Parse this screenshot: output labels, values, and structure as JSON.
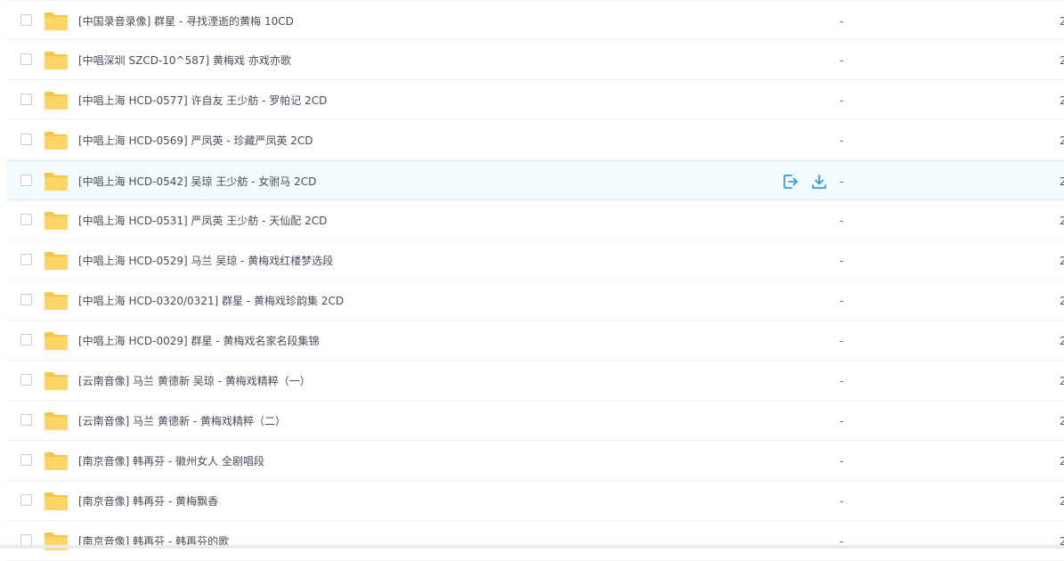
{
  "colors": {
    "accent": "#2f9cf0",
    "folder": "#ffd666",
    "hover_bg": "#f4fbff"
  },
  "icons": {
    "folder": "folder-icon",
    "share": "share-icon",
    "download": "download-icon"
  },
  "rows": [
    {
      "name": "[中国录音录像] 群星 - 寻找湮逝的黄梅 10CD",
      "size": "-",
      "edge": "2"
    },
    {
      "name": "[中唱深圳 SZCD-10^587] 黄梅戏 亦戏亦歌",
      "size": "-",
      "edge": "2"
    },
    {
      "name": "[中唱上海 HCD-0577] 许自友 王少舫 - 罗帕记 2CD",
      "size": "-",
      "edge": "2"
    },
    {
      "name": "[中唱上海 HCD-0569] 严凤英 - 珍藏严凤英 2CD",
      "size": "-",
      "edge": "2"
    },
    {
      "name": "[中唱上海 HCD-0542] 吴琼 王少舫 - 女驸马 2CD",
      "size": "-",
      "edge": "2",
      "hover": true
    },
    {
      "name": "[中唱上海 HCD-0531] 严凤英 王少舫 - 天仙配 2CD",
      "size": "-",
      "edge": "2"
    },
    {
      "name": "[中唱上海 HCD-0529] 马兰 吴琼 - 黄梅戏红楼梦选段",
      "size": "-",
      "edge": "2"
    },
    {
      "name": "[中唱上海 HCD-0320/0321] 群星 - 黄梅戏珍韵集 2CD",
      "size": "-",
      "edge": "2"
    },
    {
      "name": "[中唱上海 HCD-0029] 群星 - 黄梅戏名家名段集锦",
      "size": "-",
      "edge": "2"
    },
    {
      "name": "[云南音像] 马兰 黄德新 吴琼 - 黄梅戏精粹（一）",
      "size": "-",
      "edge": "2"
    },
    {
      "name": "[云南音像] 马兰 黄德新 - 黄梅戏精粹（二）",
      "size": "-",
      "edge": "2"
    },
    {
      "name": "[南京音像] 韩再芬 - 徽州女人 全剧唱段",
      "size": "-",
      "edge": "2"
    },
    {
      "name": "[南京音像] 韩再芬 - 黄梅飘香",
      "size": "-",
      "edge": "2"
    },
    {
      "name": "[南京音像] 韩再芬 - 韩再芬的歌",
      "size": "-",
      "edge": "2"
    }
  ]
}
